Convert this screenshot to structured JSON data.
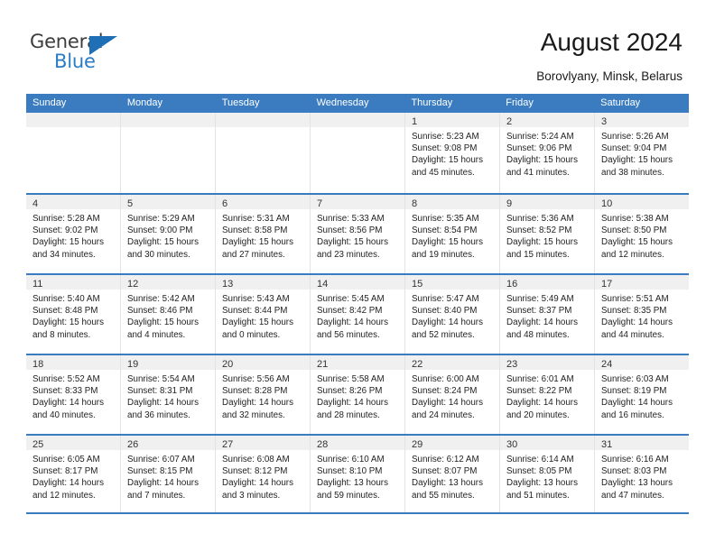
{
  "brand": {
    "name_top": "General",
    "name_bottom": "Blue",
    "triangle_icon": "blue-triangle-icon",
    "accent_color": "#2b7cc4"
  },
  "header": {
    "title": "August 2024",
    "subtitle": "Borovlyany, Minsk, Belarus"
  },
  "calendar": {
    "header_bg": "#3b7cc0",
    "daynum_band_bg": "#f0f0f0",
    "weekdays": [
      "Sunday",
      "Monday",
      "Tuesday",
      "Wednesday",
      "Thursday",
      "Friday",
      "Saturday"
    ],
    "weeks": [
      [
        {
          "day": "",
          "lines": []
        },
        {
          "day": "",
          "lines": []
        },
        {
          "day": "",
          "lines": []
        },
        {
          "day": "",
          "lines": []
        },
        {
          "day": "1",
          "lines": [
            "Sunrise: 5:23 AM",
            "Sunset: 9:08 PM",
            "Daylight: 15 hours",
            "and 45 minutes."
          ]
        },
        {
          "day": "2",
          "lines": [
            "Sunrise: 5:24 AM",
            "Sunset: 9:06 PM",
            "Daylight: 15 hours",
            "and 41 minutes."
          ]
        },
        {
          "day": "3",
          "lines": [
            "Sunrise: 5:26 AM",
            "Sunset: 9:04 PM",
            "Daylight: 15 hours",
            "and 38 minutes."
          ]
        }
      ],
      [
        {
          "day": "4",
          "lines": [
            "Sunrise: 5:28 AM",
            "Sunset: 9:02 PM",
            "Daylight: 15 hours",
            "and 34 minutes."
          ]
        },
        {
          "day": "5",
          "lines": [
            "Sunrise: 5:29 AM",
            "Sunset: 9:00 PM",
            "Daylight: 15 hours",
            "and 30 minutes."
          ]
        },
        {
          "day": "6",
          "lines": [
            "Sunrise: 5:31 AM",
            "Sunset: 8:58 PM",
            "Daylight: 15 hours",
            "and 27 minutes."
          ]
        },
        {
          "day": "7",
          "lines": [
            "Sunrise: 5:33 AM",
            "Sunset: 8:56 PM",
            "Daylight: 15 hours",
            "and 23 minutes."
          ]
        },
        {
          "day": "8",
          "lines": [
            "Sunrise: 5:35 AM",
            "Sunset: 8:54 PM",
            "Daylight: 15 hours",
            "and 19 minutes."
          ]
        },
        {
          "day": "9",
          "lines": [
            "Sunrise: 5:36 AM",
            "Sunset: 8:52 PM",
            "Daylight: 15 hours",
            "and 15 minutes."
          ]
        },
        {
          "day": "10",
          "lines": [
            "Sunrise: 5:38 AM",
            "Sunset: 8:50 PM",
            "Daylight: 15 hours",
            "and 12 minutes."
          ]
        }
      ],
      [
        {
          "day": "11",
          "lines": [
            "Sunrise: 5:40 AM",
            "Sunset: 8:48 PM",
            "Daylight: 15 hours",
            "and 8 minutes."
          ]
        },
        {
          "day": "12",
          "lines": [
            "Sunrise: 5:42 AM",
            "Sunset: 8:46 PM",
            "Daylight: 15 hours",
            "and 4 minutes."
          ]
        },
        {
          "day": "13",
          "lines": [
            "Sunrise: 5:43 AM",
            "Sunset: 8:44 PM",
            "Daylight: 15 hours",
            "and 0 minutes."
          ]
        },
        {
          "day": "14",
          "lines": [
            "Sunrise: 5:45 AM",
            "Sunset: 8:42 PM",
            "Daylight: 14 hours",
            "and 56 minutes."
          ]
        },
        {
          "day": "15",
          "lines": [
            "Sunrise: 5:47 AM",
            "Sunset: 8:40 PM",
            "Daylight: 14 hours",
            "and 52 minutes."
          ]
        },
        {
          "day": "16",
          "lines": [
            "Sunrise: 5:49 AM",
            "Sunset: 8:37 PM",
            "Daylight: 14 hours",
            "and 48 minutes."
          ]
        },
        {
          "day": "17",
          "lines": [
            "Sunrise: 5:51 AM",
            "Sunset: 8:35 PM",
            "Daylight: 14 hours",
            "and 44 minutes."
          ]
        }
      ],
      [
        {
          "day": "18",
          "lines": [
            "Sunrise: 5:52 AM",
            "Sunset: 8:33 PM",
            "Daylight: 14 hours",
            "and 40 minutes."
          ]
        },
        {
          "day": "19",
          "lines": [
            "Sunrise: 5:54 AM",
            "Sunset: 8:31 PM",
            "Daylight: 14 hours",
            "and 36 minutes."
          ]
        },
        {
          "day": "20",
          "lines": [
            "Sunrise: 5:56 AM",
            "Sunset: 8:28 PM",
            "Daylight: 14 hours",
            "and 32 minutes."
          ]
        },
        {
          "day": "21",
          "lines": [
            "Sunrise: 5:58 AM",
            "Sunset: 8:26 PM",
            "Daylight: 14 hours",
            "and 28 minutes."
          ]
        },
        {
          "day": "22",
          "lines": [
            "Sunrise: 6:00 AM",
            "Sunset: 8:24 PM",
            "Daylight: 14 hours",
            "and 24 minutes."
          ]
        },
        {
          "day": "23",
          "lines": [
            "Sunrise: 6:01 AM",
            "Sunset: 8:22 PM",
            "Daylight: 14 hours",
            "and 20 minutes."
          ]
        },
        {
          "day": "24",
          "lines": [
            "Sunrise: 6:03 AM",
            "Sunset: 8:19 PM",
            "Daylight: 14 hours",
            "and 16 minutes."
          ]
        }
      ],
      [
        {
          "day": "25",
          "lines": [
            "Sunrise: 6:05 AM",
            "Sunset: 8:17 PM",
            "Daylight: 14 hours",
            "and 12 minutes."
          ]
        },
        {
          "day": "26",
          "lines": [
            "Sunrise: 6:07 AM",
            "Sunset: 8:15 PM",
            "Daylight: 14 hours",
            "and 7 minutes."
          ]
        },
        {
          "day": "27",
          "lines": [
            "Sunrise: 6:08 AM",
            "Sunset: 8:12 PM",
            "Daylight: 14 hours",
            "and 3 minutes."
          ]
        },
        {
          "day": "28",
          "lines": [
            "Sunrise: 6:10 AM",
            "Sunset: 8:10 PM",
            "Daylight: 13 hours",
            "and 59 minutes."
          ]
        },
        {
          "day": "29",
          "lines": [
            "Sunrise: 6:12 AM",
            "Sunset: 8:07 PM",
            "Daylight: 13 hours",
            "and 55 minutes."
          ]
        },
        {
          "day": "30",
          "lines": [
            "Sunrise: 6:14 AM",
            "Sunset: 8:05 PM",
            "Daylight: 13 hours",
            "and 51 minutes."
          ]
        },
        {
          "day": "31",
          "lines": [
            "Sunrise: 6:16 AM",
            "Sunset: 8:03 PM",
            "Daylight: 13 hours",
            "and 47 minutes."
          ]
        }
      ]
    ]
  }
}
